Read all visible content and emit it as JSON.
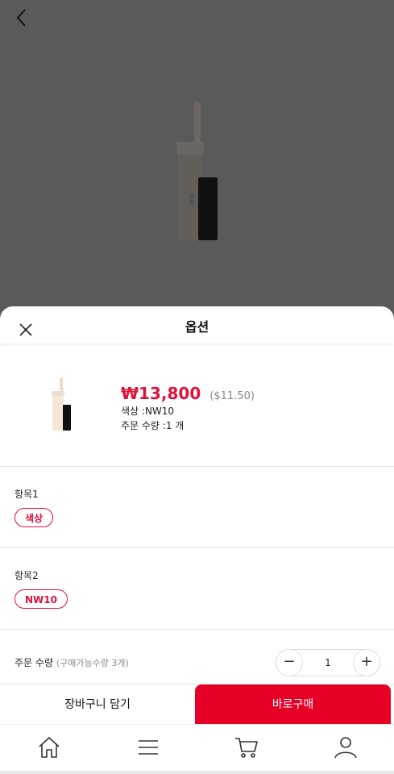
{
  "colors": {
    "accent": "#e0113b",
    "buy_button": "#e60026",
    "backdrop": "#5a5a5a"
  },
  "sheet": {
    "title": "옵션"
  },
  "product": {
    "price": "₩13,800",
    "price_usd": "($11.50)",
    "color_line": "색상 :NW10",
    "qty_line": "주문 수량 :1 개"
  },
  "options": [
    {
      "label": "항목1",
      "chip": "색상"
    },
    {
      "label": "항목2",
      "chip": "NW10"
    }
  ],
  "quantity": {
    "label": "주문 수량",
    "sub": "(구매가능수량 3개)",
    "value": "1",
    "minus": "−",
    "plus": "+"
  },
  "actions": {
    "cart": "장바구니 담기",
    "buy": "바로구매"
  },
  "icons": {
    "back": "chevron-left-icon",
    "close": "close-icon",
    "nav": [
      "home-icon",
      "menu-icon",
      "cart-icon",
      "user-icon"
    ]
  }
}
